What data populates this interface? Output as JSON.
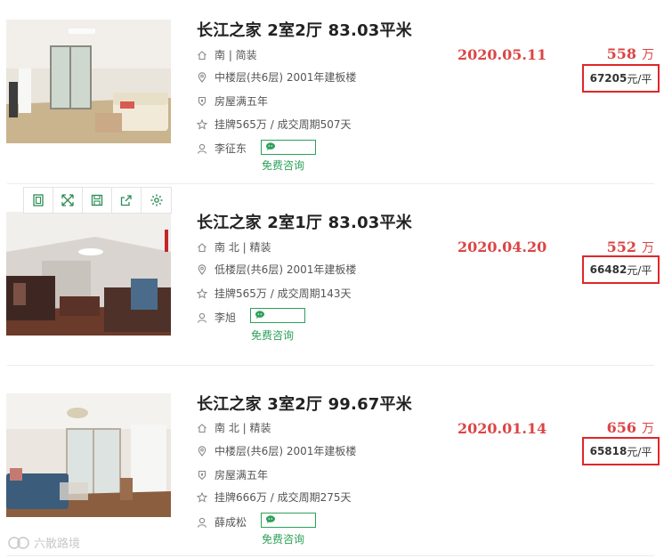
{
  "listings": [
    {
      "title": "长江之家 2室2厅 83.03平米",
      "orientation": "南 | 简装",
      "floor": "中楼层(共6层) 2001年建板楼",
      "tag": "房屋满五年",
      "listing_info": "挂牌565万 / 成交周期507天",
      "agent": "李征东",
      "date": "2020.05.11",
      "price": "558",
      "price_unit": "万",
      "unit_price": "67205",
      "unit_price_suffix": "元/平",
      "consult": "免费咨询"
    },
    {
      "title": "长江之家 2室1厅 83.03平米",
      "orientation": "南 北 | 精装",
      "floor": "低楼层(共6层) 2001年建板楼",
      "listing_info": "挂牌565万 / 成交周期143天",
      "agent": "李旭",
      "date": "2020.04.20",
      "price": "552",
      "price_unit": "万",
      "unit_price": "66482",
      "unit_price_suffix": "元/平",
      "consult": "免费咨询"
    },
    {
      "title": "长江之家 3室2厅 99.67平米",
      "orientation": "南 北 | 精装",
      "floor": "中楼层(共6层) 2001年建板楼",
      "tag": "房屋满五年",
      "listing_info": "挂牌666万 / 成交周期275天",
      "agent": "薛成松",
      "date": "2020.01.14",
      "price": "656",
      "price_unit": "万",
      "unit_price": "65818",
      "unit_price_suffix": "元/平",
      "consult": "免费咨询"
    }
  ],
  "toolbar_icons": [
    "copy-icon",
    "expand-icon",
    "save-icon",
    "share-icon",
    "settings-icon"
  ],
  "watermark": "六散路境",
  "colors": {
    "price_red": "#dc4444",
    "highlight_border": "#e0262a",
    "consult_green": "#2ea05a"
  }
}
